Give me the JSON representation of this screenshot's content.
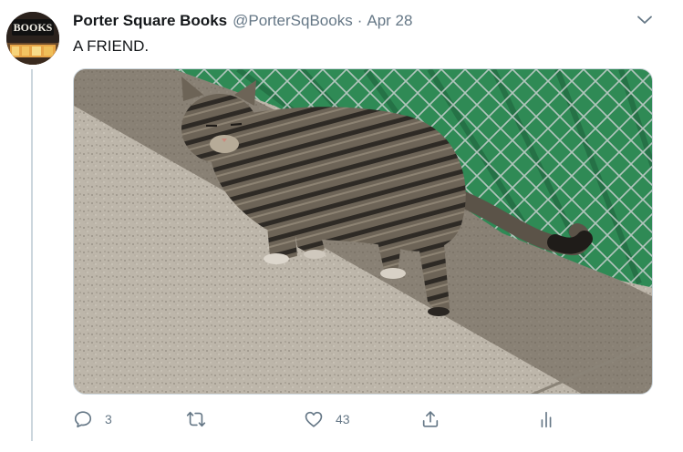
{
  "tweet": {
    "display_name": "Porter Square Books",
    "handle": "@PorterSqBooks",
    "separator": "·",
    "date": "Apr 28",
    "text": "A FRIEND.",
    "avatar_sign_text": "Books",
    "media_description_icon": "photo",
    "actions": {
      "reply_count": "3",
      "retweet_count": "",
      "like_count": "43"
    }
  },
  "colors": {
    "text_primary": "#14171a",
    "text_secondary": "#657786",
    "border": "#ccd6dd",
    "fence_green": "#2f8a55"
  }
}
